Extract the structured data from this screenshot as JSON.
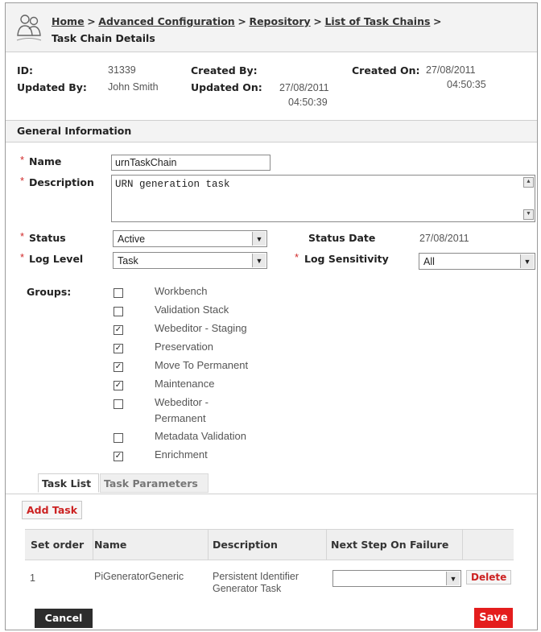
{
  "breadcrumb": {
    "links": [
      "Home",
      "Advanced Configuration",
      "Repository",
      "List of Task Chains"
    ],
    "separator": ">",
    "current": "Task Chain Details"
  },
  "meta": {
    "id_label": "ID:",
    "id_value": "31339",
    "created_by_label": "Created By:",
    "created_by_value": "",
    "created_on_label": "Created On:",
    "created_on_date": "27/08/2011",
    "created_on_time": "04:50:35",
    "updated_by_label": "Updated By:",
    "updated_by_value": "John Smith",
    "updated_on_label": "Updated On:",
    "updated_on_date": "27/08/2011",
    "updated_on_time": "04:50:39"
  },
  "section_title": "General Information",
  "form": {
    "required_mark": "*",
    "name_label": "Name",
    "name_value": "urnTaskChain",
    "description_label": "Description",
    "description_value": "URN generation task",
    "status_label": "Status",
    "status_value": "Active",
    "status_date_label": "Status Date",
    "status_date_value": "27/08/2011",
    "log_level_label": "Log Level",
    "log_level_value": "Task",
    "log_sensitivity_label": "Log Sensitivity",
    "log_sensitivity_value": "All",
    "groups_label": "Groups:",
    "groups": [
      {
        "label": "Workbench",
        "checked": false
      },
      {
        "label": "Validation Stack",
        "checked": false
      },
      {
        "label": "Webeditor - Staging",
        "checked": true
      },
      {
        "label": "Preservation",
        "checked": true
      },
      {
        "label": "Move To Permanent",
        "checked": true
      },
      {
        "label": "Maintenance",
        "checked": true
      },
      {
        "label": "Webeditor -",
        "label2": "Permanent",
        "checked": false
      },
      {
        "label": "Metadata Validation",
        "checked": false
      },
      {
        "label": "Enrichment",
        "checked": true
      }
    ]
  },
  "tabs": [
    "Task List",
    "Task Parameters"
  ],
  "add_task_label": "Add Task",
  "table": {
    "headers": [
      "Set order",
      "Name",
      "Description",
      "Next Step On Failure"
    ],
    "rows": [
      {
        "order": "1",
        "name": "PiGeneratorGeneric",
        "description_line1": "Persistent Identifier",
        "description_line2": "Generator Task",
        "next_step": "",
        "action": "Delete"
      }
    ]
  },
  "buttons": {
    "cancel": "Cancel",
    "save": "Save"
  },
  "colors": {
    "accent_red": "#e41d1d",
    "header_bg": "#f3f3f3",
    "cancel_bg": "#2d2d2d"
  }
}
